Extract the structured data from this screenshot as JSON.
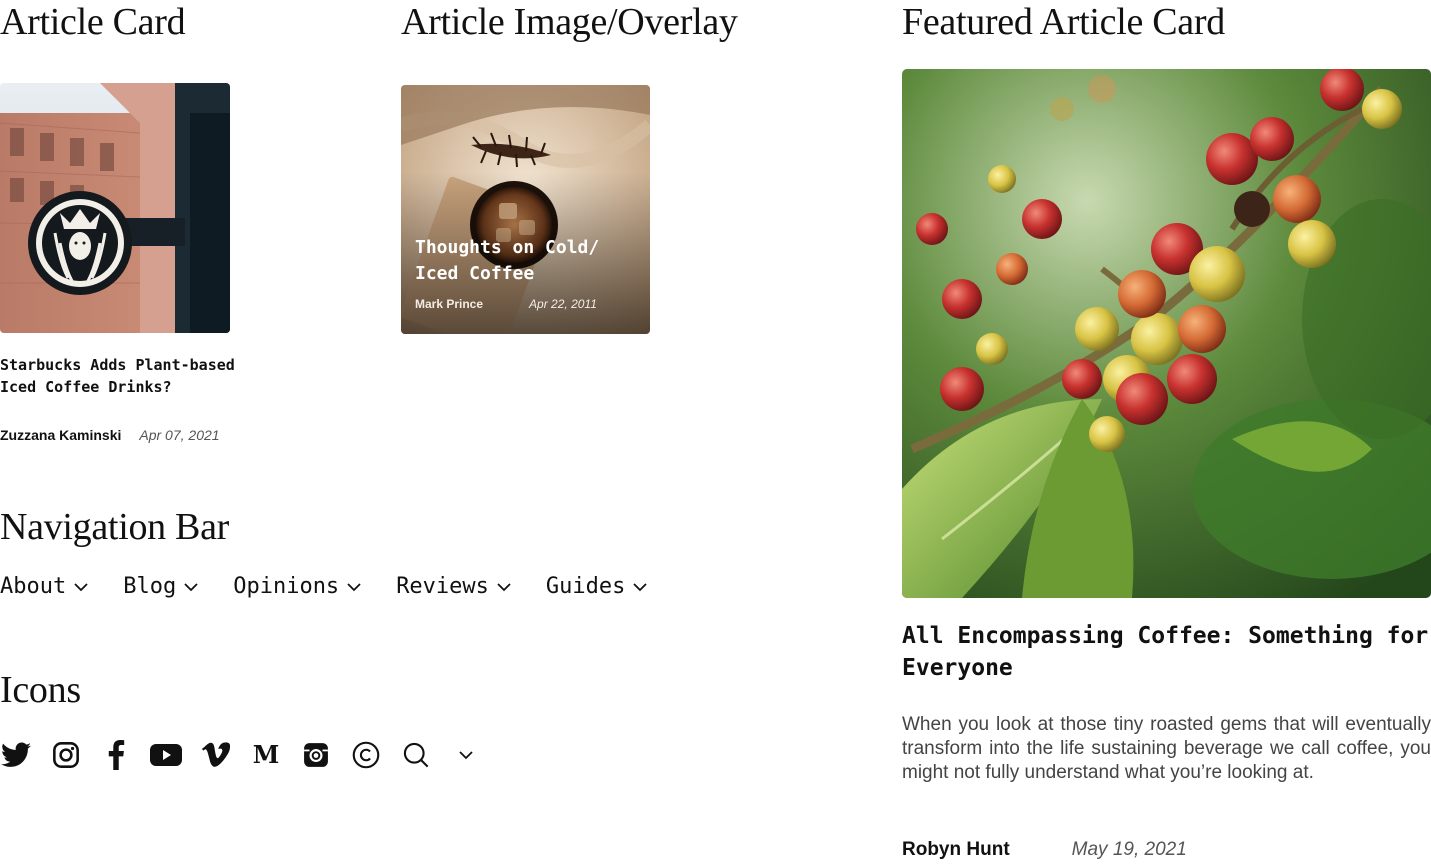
{
  "sections": {
    "article_card": "Article Card",
    "article_overlay": "Article Image/Overlay",
    "featured": "Featured Article Card",
    "navigation": "Navigation Bar",
    "icons": "Icons"
  },
  "article_card": {
    "title": "Starbucks Adds Plant-based Iced Coffee Drinks?",
    "author": "Zuzzana Kaminski",
    "date": "Apr 07, 2021"
  },
  "overlay_card": {
    "title": "Thoughts on Cold/ Iced Coffee",
    "author": "Mark Prince",
    "date": "Apr 22, 2011"
  },
  "featured_card": {
    "title": "All Encompassing Coffee: Something for Everyone",
    "description": "When you look at those tiny roasted gems that will eventually transform into the life sustaining beverage we call coffee, you might not fully understand what you’re looking at.",
    "author": "Robyn Hunt",
    "date": "May 19, 2021"
  },
  "nav": {
    "items": [
      {
        "label": "About"
      },
      {
        "label": "Blog"
      },
      {
        "label": "Opinions"
      },
      {
        "label": "Reviews"
      },
      {
        "label": "Guides"
      }
    ]
  },
  "icons": [
    "twitter-icon",
    "instagram-icon",
    "facebook-icon",
    "youtube-icon",
    "vimeo-icon",
    "medium-icon",
    "instagram-square-icon",
    "copyright-icon",
    "search-icon",
    "chevron-down-icon"
  ]
}
